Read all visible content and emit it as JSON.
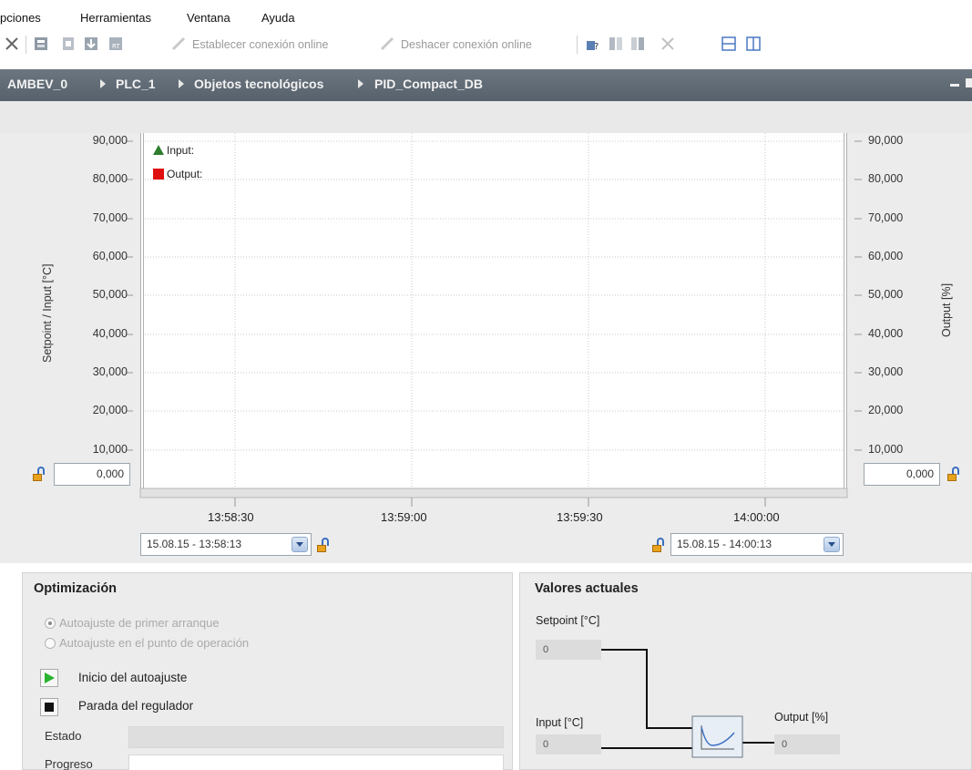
{
  "menu": [
    "pciones",
    "Herramientas",
    "Ventana",
    "Ayuda"
  ],
  "toolbar": {
    "go_online": "Establecer conexión online",
    "go_offline": "Deshacer conexión online"
  },
  "breadcrumb": [
    "AMBEV_0",
    "PLC_1",
    "Objetos tecnológicos",
    "PID_Compact_DB"
  ],
  "chart": {
    "left_ticks": [
      "90,000",
      "80,000",
      "70,000",
      "60,000",
      "50,000",
      "40,000",
      "30,000",
      "20,000",
      "10,000"
    ],
    "right_ticks": [
      "90,000",
      "80,000",
      "70,000",
      "60,000",
      "50,000",
      "40,000",
      "30,000",
      "20,000",
      "10,000"
    ],
    "left_axis_title": "Setpoint / Input  [°C]",
    "right_axis_title": "Output  [%]",
    "legend": {
      "input": "Input:",
      "output": "Output:"
    },
    "x_ticks": [
      "13:58:30",
      "13:59:00",
      "13:59:30",
      "14:00:00"
    ],
    "left_min": "0,000",
    "right_min": "0,000",
    "start_time": "15.08.15 - 13:58:13",
    "end_time": "15.08.15 - 14:00:13"
  },
  "optimizacion": {
    "title": "Optimización",
    "radio1": "Autoajuste de primer arranque",
    "radio2": "Autoajuste en el punto de operación",
    "start_label": "Inicio del autoajuste",
    "stop_label": "Parada del regulador",
    "estado_label": "Estado",
    "progreso_label": "Progreso"
  },
  "valores": {
    "title": "Valores actuales",
    "setpoint_label": "Setpoint [°C]",
    "setpoint_value": "0",
    "input_label": "Input [°C]",
    "input_value": "0",
    "output_label": "Output [%]",
    "output_value": "0"
  }
}
